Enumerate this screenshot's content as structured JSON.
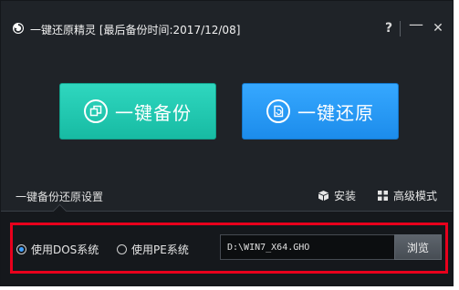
{
  "window": {
    "title": "一键还原精灵 [最后备份时间:2017/12/08]",
    "help_label": "?",
    "minimize_label": "—",
    "close_label": "✕",
    "app_icon": "refresh-swirl-icon"
  },
  "main": {
    "backup_label": "一键备份",
    "backup_icon": "copy-icon",
    "restore_label": "一键还原",
    "restore_icon": "restore-file-icon"
  },
  "settings": {
    "title": "一键备份还原设置",
    "install_label": "安装",
    "install_icon": "box-icon",
    "advanced_label": "高级模式",
    "advanced_icon": "grid-icon"
  },
  "options": {
    "dos_label": "使用DOS系统",
    "dos_selected": true,
    "pe_label": "使用PE系统",
    "pe_selected": false,
    "path_value": "D:\\WIN7_X64.GHO",
    "browse_label": "浏览"
  },
  "colors": {
    "background": "#1f2328",
    "backup_button": "#1fc7af",
    "restore_button": "#2899f5",
    "highlight_frame": "#e8001c"
  }
}
